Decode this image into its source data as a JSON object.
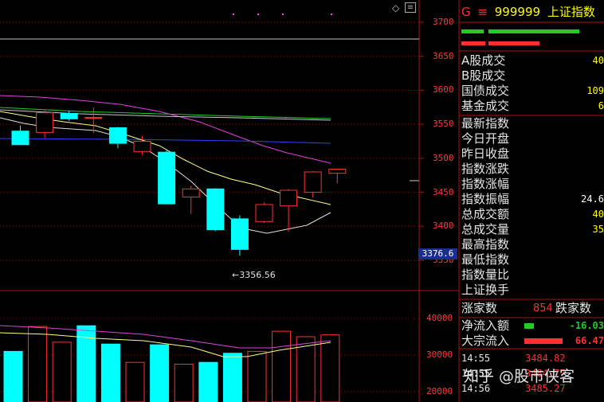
{
  "chart_data": {
    "type": "candlestick",
    "y_ticks": [
      3700,
      3650,
      3600,
      3550,
      3500,
      3450,
      3400,
      3350
    ],
    "ylim": [
      3335,
      3713
    ],
    "candles": [
      {
        "open": 3540,
        "close": 3520,
        "high": 3548,
        "low": 3520
      },
      {
        "open": 3538,
        "close": 3567,
        "high": 3571,
        "low": 3530
      },
      {
        "open": 3566,
        "close": 3558,
        "high": 3570,
        "low": 3555
      },
      {
        "open": 3560,
        "close": 3560,
        "high": 3575,
        "low": 3537
      },
      {
        "open": 3545,
        "close": 3522,
        "high": 3546,
        "low": 3515
      },
      {
        "open": 3510,
        "close": 3525,
        "high": 3533,
        "low": 3505
      },
      {
        "open": 3509,
        "close": 3433,
        "high": 3512,
        "low": 3433
      },
      {
        "open": 3443,
        "close": 3455,
        "high": 3460,
        "low": 3418
      },
      {
        "open": 3455,
        "close": 3395,
        "high": 3456,
        "low": 3393
      },
      {
        "open": 3411,
        "close": 3366,
        "high": 3416,
        "low": 3357
      },
      {
        "open": 3407,
        "close": 3432,
        "high": 3435,
        "low": 3405
      },
      {
        "open": 3430,
        "close": 3453,
        "high": 3455,
        "low": 3392
      },
      {
        "open": 3450,
        "close": 3480,
        "high": 3481,
        "low": 3442
      },
      {
        "open": 3478,
        "close": 3484,
        "high": 3484,
        "low": 3463
      }
    ],
    "annotations": {
      "low_label": "3356.56",
      "current_price": "3376.6"
    },
    "volume_ticks": [
      "40000",
      "30000",
      "20000"
    ],
    "volume_ylim": [
      15000,
      47000
    ],
    "volumes": [
      31000,
      37800,
      33500,
      38000,
      33000,
      28000,
      32800,
      27500,
      28000,
      30500,
      31000,
      36500,
      35000,
      35500
    ],
    "volume_up": [
      false,
      true,
      true,
      false,
      false,
      true,
      false,
      true,
      false,
      false,
      true,
      true,
      true,
      true
    ]
  },
  "header": {
    "code_prefix": "G",
    "menu_glyph": "≡",
    "code": "999999",
    "name": "上证指数"
  },
  "stats": [
    {
      "label": "A股成交",
      "value": "40"
    },
    {
      "label": "B股成交",
      "value": ""
    },
    {
      "label": "国债成交",
      "value": "109"
    },
    {
      "label": "基金成交",
      "value": "6"
    }
  ],
  "index_info": [
    {
      "label": "最新指数",
      "value": ""
    },
    {
      "label": "今日开盘",
      "value": ""
    },
    {
      "label": "昨日收盘",
      "value": ""
    },
    {
      "label": "指数涨跌",
      "value": ""
    },
    {
      "label": "指数涨幅",
      "value": ""
    },
    {
      "label": "指数振幅",
      "value": "24.6"
    },
    {
      "label": "总成交额",
      "value": "40"
    },
    {
      "label": "总成交量",
      "value": "35"
    },
    {
      "label": "最高指数",
      "value": ""
    },
    {
      "label": "最低指数",
      "value": ""
    },
    {
      "label": "指数量比",
      "value": ""
    },
    {
      "label": "上证换手",
      "value": ""
    }
  ],
  "breadth": {
    "up_label": "涨家数",
    "up_value": "854",
    "down_label": "跌家数"
  },
  "flows": [
    {
      "label": "净流入额",
      "value": "-16.03",
      "bar_color": "#22cc22"
    },
    {
      "label": "大宗流入",
      "value": "66.47",
      "bar_color": "#ff3030"
    }
  ],
  "ticks": [
    {
      "time": "14:55",
      "price": "3484.82"
    },
    {
      "time": "14:55",
      "price": "3484.77"
    },
    {
      "time": "14:56",
      "price": "3485.27"
    }
  ],
  "watermark": "知乎 @股市侠客"
}
